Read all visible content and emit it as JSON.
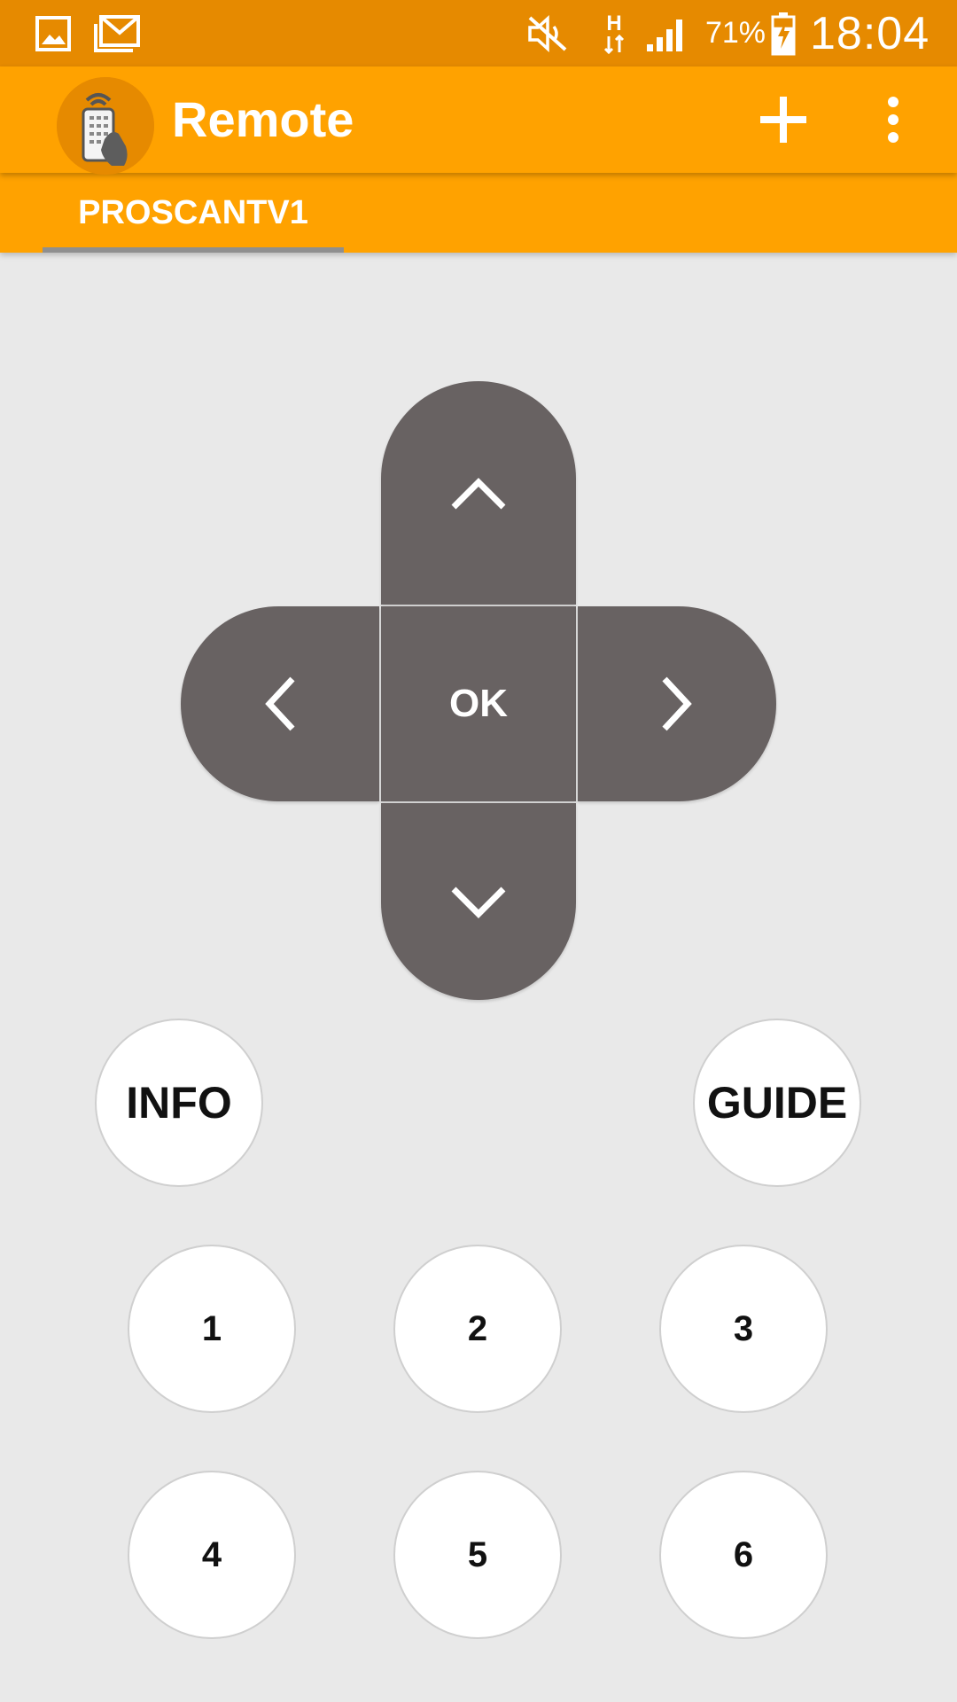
{
  "status_bar": {
    "icons": {
      "gallery": "image-icon",
      "mail": "gmail-icon",
      "mute": "volume-mute-icon",
      "network": "hspa-data-icon",
      "signal": "signal-icon",
      "battery": "battery-charging-icon"
    },
    "network_label": "H",
    "battery_percent": "71%",
    "battery_level": 0.71,
    "time": "18:04"
  },
  "app_bar": {
    "title": "Remote",
    "actions": {
      "add": "add-icon",
      "more": "more-vert-icon"
    }
  },
  "tabs": [
    {
      "label": "PROSCANTV1",
      "selected": true
    }
  ],
  "dpad": {
    "ok_label": "OK",
    "icons": {
      "up": "chevron-up-icon",
      "down": "chevron-down-icon",
      "left": "chevron-left-icon",
      "right": "chevron-right-icon"
    }
  },
  "buttons": {
    "info": "INFO",
    "guide": "GUIDE",
    "numbers": [
      "1",
      "2",
      "3",
      "4",
      "5",
      "6"
    ]
  },
  "colors": {
    "status_bar": "#e68a00",
    "app_bar": "#ffa200",
    "dpad": "#686262",
    "background": "#e9e9e9"
  }
}
